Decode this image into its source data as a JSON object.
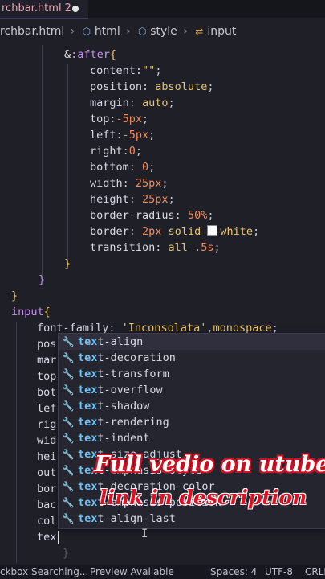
{
  "tab": {
    "title": "rchbar.html",
    "problems": "2"
  },
  "breadcrumb": {
    "file": "rchbar.html",
    "items": [
      "html",
      "style",
      "input"
    ]
  },
  "code": {
    "after_selector_amp": "&",
    "after_selector_pseudo": ":after",
    "after_brace": "{",
    "content_prop": "content",
    "content_val": "\"\"",
    "position_prop": "position",
    "position_val": "absolute",
    "margin_prop": "margin",
    "margin_val": "auto",
    "top_prop": "top",
    "top_val": "-5px",
    "left_prop": "left",
    "left_val": "-5px",
    "right_prop": "right",
    "right_val": "0",
    "bottom_prop": "bottom",
    "bottom_val": "0",
    "width_prop": "width",
    "width_val": "25px",
    "height_prop": "height",
    "height_val": "25px",
    "radius_prop": "border-radius",
    "radius_val": "50%",
    "border_prop": "border",
    "border_val_num": "2px",
    "border_val_style": "solid",
    "border_val_color": "white",
    "transition_prop": "transition",
    "transition_val_kw": "all",
    "transition_val_num": ".5s",
    "close_inner": "}",
    "close_mid": "}",
    "close_outer": "}",
    "input_selector": "input",
    "input_brace": "{",
    "font_prop": "font-family",
    "font_val_str": "'Inconsolata'",
    "font_val_kw": "monospace",
    "partial_lines": [
      "pos",
      "mar",
      "top",
      "bot",
      "lef",
      "rig",
      "wid",
      "hei",
      "out",
      "bor",
      "bac",
      "col"
    ],
    "typing": "tex"
  },
  "suggestions": {
    "typed_prefix": "tex",
    "items": [
      "text-align",
      "text-decoration",
      "text-transform",
      "text-overflow",
      "text-shadow",
      "text-rendering",
      "text-indent",
      "text-size-adjust",
      "text-emphasis-style",
      "text-decoration-color",
      "text-emphasis-position",
      "text-align-last"
    ]
  },
  "overlay": {
    "line1": "Full vedio on utube",
    "line2": "link in description"
  },
  "statusbar": {
    "left": "ckbox Searching...",
    "preview": "Preview Available",
    "spaces": "Spaces: 4",
    "encoding": "UTF-8",
    "eol": "CRLF"
  }
}
